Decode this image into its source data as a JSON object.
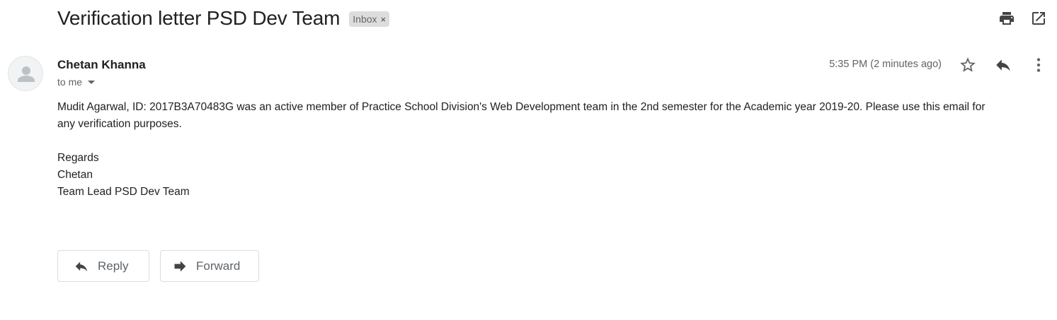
{
  "message": {
    "subject": "Verification letter PSD Dev Team",
    "label": "Inbox",
    "label_remove": "×",
    "sender": "Chetan Khanna",
    "recipient": "to me",
    "timestamp": "5:35 PM (2 minutes ago)",
    "body": {
      "paragraph1_line1": "Mudit Agarwal, ID: 2017B3A70483G was an active member of Practice School Division's Web Development team in the 2nd semester for the Academic year 2019-20. Please use this email for",
      "paragraph1_line2": "any verification purposes.",
      "signature": [
        "Regards",
        "Chetan",
        "Team Lead PSD Dev Team"
      ]
    }
  },
  "actions": {
    "reply_label": "Reply",
    "forward_label": "Forward"
  },
  "icons": {
    "print": "print-icon",
    "open_new_window": "open-in-new-icon",
    "star": "star-outline-icon",
    "reply": "reply-icon",
    "more": "more-vert-icon",
    "avatar": "default-avatar-icon",
    "forward": "forward-icon"
  }
}
